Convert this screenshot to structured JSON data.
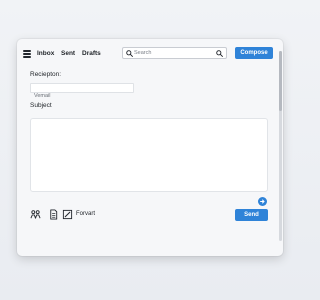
{
  "nav": {
    "menu_icon": "hamburger-menu-icon",
    "tabs": [
      {
        "label": "Inbox"
      },
      {
        "label": "Sent"
      },
      {
        "label": "Drafts"
      }
    ]
  },
  "search": {
    "placeholder": "Search",
    "value": "",
    "icon": "search-icon"
  },
  "toolbar": {
    "compose_label": "Compose"
  },
  "form": {
    "recipient_label": "Reciepton:",
    "recipient_placeholder": "Vemail",
    "subject_label": "Subject",
    "body_value": ""
  },
  "footer": {
    "tools": [
      {
        "icon": "people-icon"
      },
      {
        "icon": "document-icon"
      },
      {
        "icon": "edit-icon"
      }
    ],
    "forvart_label": "Forvart",
    "send_label": "Send",
    "fab_icon": "arrow-right-icon"
  },
  "colors": {
    "accent": "#2f83d8",
    "window_bg": "#f6f7f9",
    "page_bg": "#eceff3"
  }
}
